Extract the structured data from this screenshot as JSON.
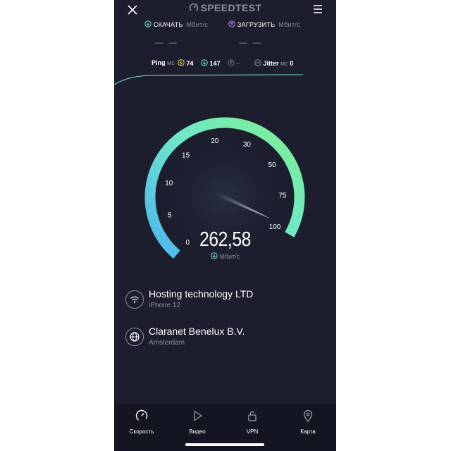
{
  "header": {
    "logo_text": "SPEEDTEST",
    "close_icon": "close-icon",
    "menu_icon": "menu-icon"
  },
  "download": {
    "label": "СКАЧАТЬ",
    "unit": "Мбит/с",
    "value": "— —",
    "icon": "download-icon",
    "color": "#6de0c8"
  },
  "upload": {
    "label": "ЗАГРУЗИТЬ",
    "unit": "Мбит/с",
    "value": "— —",
    "icon": "upload-icon",
    "color": "#b98af2"
  },
  "ping": {
    "label": "Ping",
    "unit": "мс",
    "idle": "74",
    "download": "147",
    "upload": "--",
    "jitter_label": "Jitter",
    "jitter_unit": "мс",
    "jitter": "0",
    "idle_color": "#e8d44d"
  },
  "gauge": {
    "value": 262.58,
    "display_value": "262,58",
    "unit": "Мбит/с",
    "ticks": [
      "0",
      "5",
      "10",
      "15",
      "20",
      "30",
      "50",
      "75",
      "100"
    ],
    "color_start": "#49b6f0",
    "color_end": "#7ff08e"
  },
  "provider": {
    "name": "Hosting technology LTD",
    "device": "iPhone 12",
    "icon": "wifi-icon"
  },
  "server": {
    "name": "Claranet Benelux B.V.",
    "location": "Amsterdam",
    "icon": "globe-icon"
  },
  "tabs": [
    {
      "label": "Скорость",
      "icon": "speedometer-icon",
      "active": true
    },
    {
      "label": "Видео",
      "icon": "play-icon",
      "active": false
    },
    {
      "label": "VPN",
      "icon": "lock-icon",
      "active": false
    },
    {
      "label": "Карта",
      "icon": "map-pin-icon",
      "active": false
    }
  ]
}
